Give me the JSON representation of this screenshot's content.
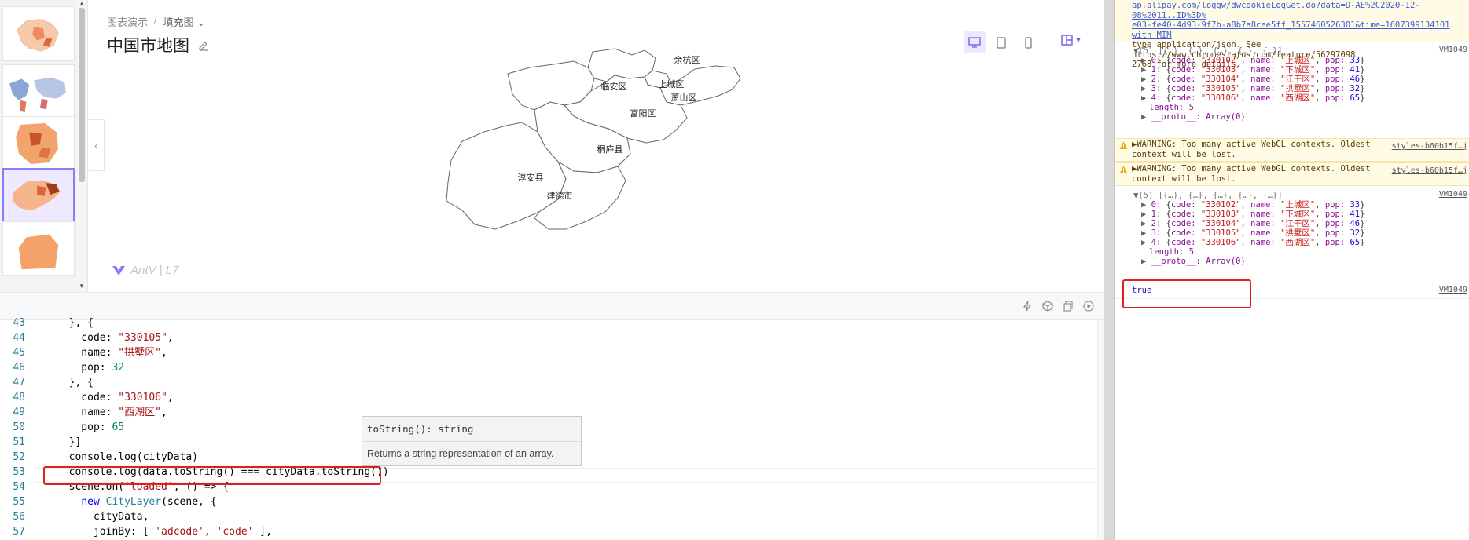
{
  "thumbnails": {
    "count": 5,
    "active_index": 3
  },
  "chart_header": {
    "breadcrumb": [
      "图表演示",
      "填充图"
    ],
    "breadcrumb_dropdown": "chevron-down-icon",
    "title": "中国市地图"
  },
  "map": {
    "districts": [
      "余杭区",
      "临安区",
      "上城区",
      "萧山区",
      "富阳区",
      "桐庐县",
      "淳安县",
      "建德市"
    ],
    "brand": "AntV | L7"
  },
  "editor": {
    "lines": [
      {
        "n": "43",
        "tokens": [
          [
            "pl",
            "  }, {"
          ]
        ]
      },
      {
        "n": "44",
        "tokens": [
          [
            "pl",
            "    code: "
          ],
          [
            "str",
            "\"330105\""
          ],
          [
            "pl",
            ","
          ]
        ]
      },
      {
        "n": "45",
        "tokens": [
          [
            "pl",
            "    name: "
          ],
          [
            "str",
            "\"拱墅区\""
          ],
          [
            "pl",
            ","
          ]
        ]
      },
      {
        "n": "46",
        "tokens": [
          [
            "pl",
            "    pop: "
          ],
          [
            "num",
            "32"
          ]
        ]
      },
      {
        "n": "47",
        "tokens": [
          [
            "pl",
            "  }, {"
          ]
        ]
      },
      {
        "n": "48",
        "tokens": [
          [
            "pl",
            "    code: "
          ],
          [
            "str",
            "\"330106\""
          ],
          [
            "pl",
            ","
          ]
        ]
      },
      {
        "n": "49",
        "tokens": [
          [
            "pl",
            "    name: "
          ],
          [
            "str",
            "\"西湖区\""
          ],
          [
            "pl",
            ","
          ]
        ]
      },
      {
        "n": "50",
        "tokens": [
          [
            "pl",
            "    pop: "
          ],
          [
            "num",
            "65"
          ]
        ]
      },
      {
        "n": "51",
        "tokens": [
          [
            "pl",
            "  }]"
          ]
        ]
      },
      {
        "n": "52",
        "tokens": [
          [
            "pl",
            "  console.log(cityData)"
          ]
        ]
      },
      {
        "n": "53",
        "tokens": [
          [
            "pl",
            "  console.log(data.toString() === cityData.toString())"
          ]
        ]
      },
      {
        "n": "54",
        "tokens": [
          [
            "pl",
            "  scene.on("
          ],
          [
            "str",
            "'loaded'"
          ],
          [
            "pl",
            ", () => {"
          ]
        ]
      },
      {
        "n": "55",
        "tokens": [
          [
            "pl",
            "    "
          ],
          [
            "kw",
            "new"
          ],
          [
            "pl",
            " "
          ],
          [
            "cls",
            "CityLayer"
          ],
          [
            "pl",
            "(scene, {"
          ]
        ]
      },
      {
        "n": "56",
        "tokens": [
          [
            "pl",
            "      cityData,"
          ]
        ]
      },
      {
        "n": "57",
        "tokens": [
          [
            "pl",
            "      joinBy: [ "
          ],
          [
            "str",
            "'adcode'"
          ],
          [
            "pl",
            ", "
          ],
          [
            "str",
            "'code'"
          ],
          [
            "pl",
            " ],"
          ]
        ]
      }
    ],
    "tooltip": {
      "signature": "toString(): string",
      "doc": "Returns a string representation of an array."
    }
  },
  "console": {
    "top_warning": [
      "ap.alipay.com/loggw/dwcookieLogGet.do?data=D-AE%2C2020-12-08%2011..ID%3D%",
      "e03-fe40-4d93-9f7b-a8b7a8cee5ff_1557460526301&time=1607399134101 with MIM",
      "type application/json. See https://www.chromestatus.com/feature/56297098",
      "2768 for more details."
    ],
    "arrays": [
      {
        "summary": "(5) [{…}, {…}, {…}, {…}, {…}]",
        "source": "VM1049",
        "items": [
          {
            "i": "0",
            "code": "\"330102\"",
            "name": "\"上城区\"",
            "pop": "33"
          },
          {
            "i": "1",
            "code": "\"330103\"",
            "name": "\"下城区\"",
            "pop": "41"
          },
          {
            "i": "2",
            "code": "\"330104\"",
            "name": "\"江干区\"",
            "pop": "46"
          },
          {
            "i": "3",
            "code": "\"330105\"",
            "name": "\"拱墅区\"",
            "pop": "32"
          },
          {
            "i": "4",
            "code": "\"330106\"",
            "name": "\"西湖区\"",
            "pop": "65"
          }
        ],
        "length": "length: 5",
        "proto": "__proto__: Array(0)"
      }
    ],
    "webgl_warning": {
      "line1": "▶WARNING: Too many active WebGL contexts. Oldest",
      "line2": "context will be lost.",
      "source": "styles-b60b15f…j"
    },
    "result": "true",
    "result_source": "VM1049"
  },
  "colors": {
    "accent": "#6b5bea",
    "highlight": "#e02020"
  }
}
